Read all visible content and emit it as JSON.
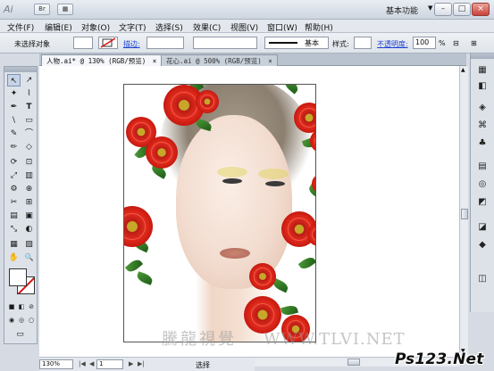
{
  "titlebar": {
    "app_icon": "Ai",
    "br_label": "Br",
    "arrange_label": "▦",
    "workspace": "基本功能",
    "win_buttons": [
      "–",
      "□",
      "×"
    ]
  },
  "menu": [
    "文件(F)",
    "编辑(E)",
    "对象(O)",
    "文字(T)",
    "选择(S)",
    "效果(C)",
    "视图(V)",
    "窗口(W)",
    "帮助(H)"
  ],
  "control": {
    "selection_status": "未选择对象",
    "stroke_label": "描边:",
    "brush_label": "基本",
    "style_label": "样式:",
    "opacity_label": "不透明度:",
    "opacity_value": "100",
    "opacity_unit": "%"
  },
  "tabs": [
    {
      "label": "人物.ai* @ 130% (RGB/预览)",
      "close": "×"
    },
    {
      "label": "花心.ai @ 500% (RGB/预览)",
      "close": "×"
    }
  ],
  "tools": [
    "↖",
    "↗",
    "✦",
    "⌇",
    "✒",
    "T",
    "\\",
    "▭",
    "✎",
    "⌒",
    "✏",
    "◇",
    "⟳",
    "⊡",
    "⤢",
    "▥",
    "⚙",
    "⊕",
    "✂",
    "⊞",
    "▤",
    "▣",
    "⤡",
    "◐",
    "▦",
    "▧",
    "✋",
    "🔍"
  ],
  "canvas": {
    "watermark": "騰龍視覺",
    "watermark_url": "WWW.TLVI.NET"
  },
  "statusbar": {
    "zoom": "130%",
    "page": "1",
    "mode": "选择"
  },
  "corner_logo": "Ps123.Net",
  "dock_icons": [
    "▦",
    "◧",
    "◈",
    "⌘",
    "♣",
    "▤",
    "◎",
    "◩",
    "◪",
    "◆",
    "◫"
  ]
}
